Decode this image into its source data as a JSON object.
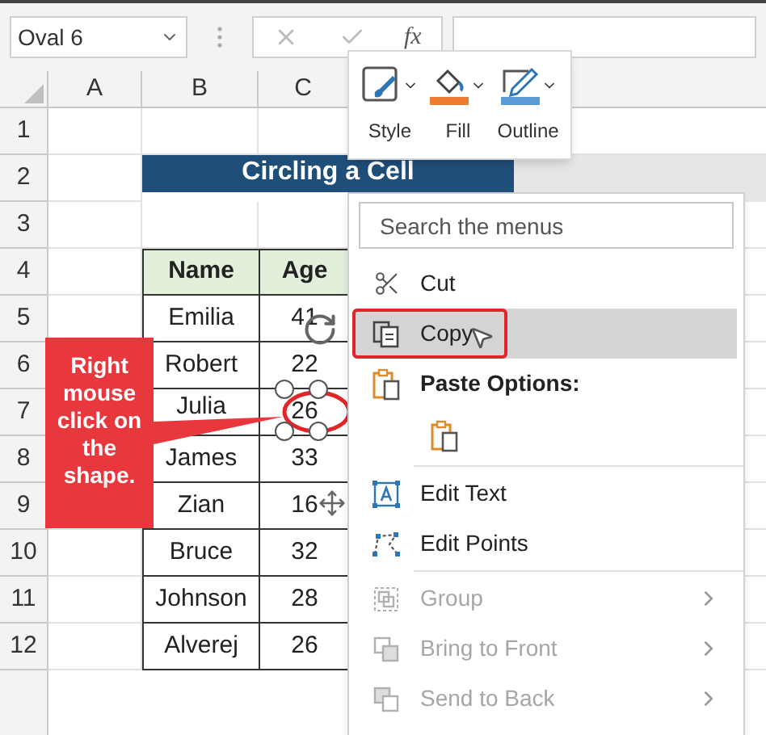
{
  "name_box": {
    "value": "Oval 6"
  },
  "formula_bar": {
    "function_label": "fx"
  },
  "columns": [
    "A",
    "B",
    "C"
  ],
  "row_numbers": [
    "1",
    "2",
    "3",
    "4",
    "5",
    "6",
    "7",
    "8",
    "9",
    "10",
    "11",
    "12"
  ],
  "title": "Circling a Cell",
  "table": {
    "headers": [
      "Name",
      "Age"
    ],
    "rows": [
      [
        "Emilia",
        "41"
      ],
      [
        "Robert",
        "22"
      ],
      [
        "Julia",
        "26"
      ],
      [
        "James",
        "33"
      ],
      [
        "Zian",
        "16"
      ],
      [
        "Bruce",
        "32"
      ],
      [
        "Johnson",
        "28"
      ],
      [
        "Alverej",
        "26"
      ]
    ]
  },
  "mini_toolbar": [
    {
      "kind": "style",
      "label": "Style"
    },
    {
      "kind": "fill",
      "label": "Fill",
      "color": "#ed7d31"
    },
    {
      "kind": "outline",
      "label": "Outline",
      "color": "#5b9bd5"
    }
  ],
  "context_menu": {
    "search": {
      "placeholder": "Search the menus"
    },
    "items": [
      {
        "kind": "cut",
        "label": "Cut",
        "selected": false,
        "disabled": false,
        "submenu": false
      },
      {
        "kind": "copy",
        "label": "Copy",
        "selected": true,
        "disabled": false,
        "submenu": false
      },
      {
        "kind": "paste_header",
        "label": "Paste Options:",
        "selected": false,
        "disabled": false,
        "submenu": false
      },
      {
        "kind": "paste_button",
        "selected": false,
        "disabled": false,
        "submenu": false
      },
      {
        "kind": "separator"
      },
      {
        "kind": "edit_text",
        "label": "Edit Text",
        "selected": false,
        "disabled": false,
        "submenu": false
      },
      {
        "kind": "edit_points",
        "label": "Edit Points",
        "selected": false,
        "disabled": false,
        "submenu": false
      },
      {
        "kind": "separator"
      },
      {
        "kind": "group",
        "label": "Group",
        "selected": false,
        "disabled": true,
        "submenu": true
      },
      {
        "kind": "bring_front",
        "label": "Bring to Front",
        "selected": false,
        "disabled": true,
        "submenu": true
      },
      {
        "kind": "send_back",
        "label": "Send to Back",
        "selected": false,
        "disabled": true,
        "submenu": true
      }
    ]
  },
  "callout": {
    "text": "Right mouse click on the shape."
  }
}
